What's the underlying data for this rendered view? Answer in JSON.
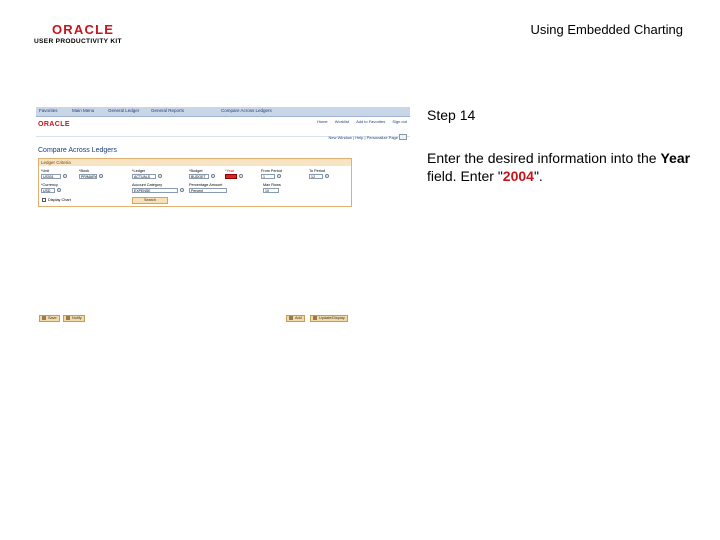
{
  "header": {
    "logo_brand": "ORACLE",
    "logo_product": "USER PRODUCTIVITY KIT",
    "doc_title": "Using Embedded Charting"
  },
  "screenshot": {
    "topbar_items": [
      "Favorites",
      "Main Menu",
      "General Ledger",
      "General Reports",
      "Compare Across Ledgers"
    ],
    "nav_links": [
      "Home",
      "Worklist",
      "Add to Favorites",
      "Sign out"
    ],
    "subnav": "New Window | Help | Personalize Page",
    "page_heading": "Compare Across Ledgers",
    "panel_title": "Ledger Criteria",
    "fields": {
      "unit_label": "*Unit",
      "unit_value": "US001",
      "book_label": "*Book",
      "book_value": "PRIMARY",
      "ledger_label": "*Ledger",
      "ledger_value": "ACTUALS",
      "budget_label": "*Budget",
      "budget_value": "BUDGET",
      "year_label": "*Year",
      "year_value": "",
      "from_period_label": "From Period",
      "from_period_value": "1",
      "to_period_label": "To Period",
      "to_period_value": "12",
      "currency_label": "*Currency",
      "currency_value": "USD",
      "account_class_label": "Account Category",
      "account_class_value": "EXPENSE",
      "percentage_label": "Percentage Amount",
      "percentage_value": "Percent",
      "max_rows_label": "Max Rows",
      "max_rows_value": "10"
    },
    "display_chart_label": "Display Chart",
    "search_button": "Search",
    "bottom_left": [
      "Save",
      "Notify"
    ],
    "bottom_right": [
      "Add",
      "Update/Display"
    ]
  },
  "instruction": {
    "step": "Step 14",
    "line_prefix": "Enter the desired information into the ",
    "field_name": "Year",
    "line_middle": " field. Enter \"",
    "value": "2004",
    "line_suffix": "\"."
  },
  "colors": {
    "oracle_red": "#c4161c",
    "nav_blue": "#1d3f77",
    "panel_orange": "#e0b070"
  }
}
